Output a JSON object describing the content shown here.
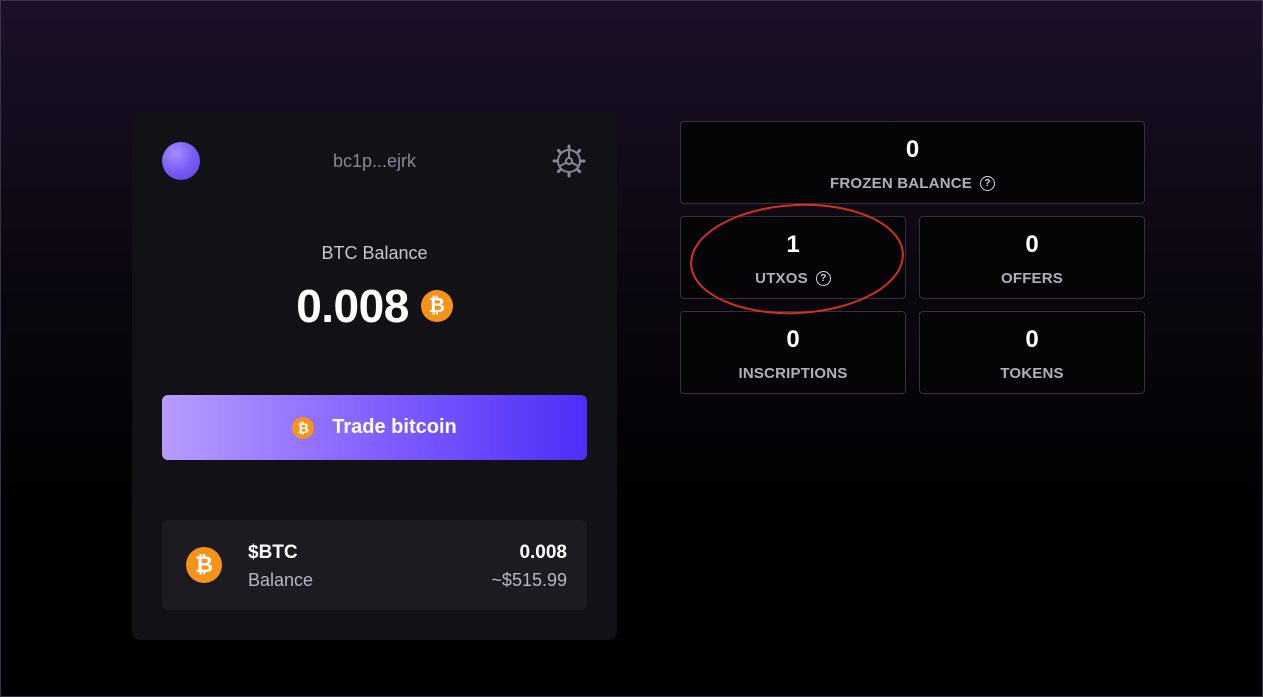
{
  "wallet": {
    "address": "bc1p...ejrk",
    "balance_label": "BTC Balance",
    "balance_value": "0.008",
    "coin_symbol": "₿",
    "trade_button": "Trade bitcoin",
    "asset": {
      "symbol": "$BTC",
      "sub": "Balance",
      "amount": "0.008",
      "usd": "~$515.99"
    },
    "icons": {
      "avatar": "avatar-gradient",
      "settings": "settings-icon",
      "coin": "bitcoin-icon"
    }
  },
  "stats": {
    "frozen": {
      "value": "0",
      "label": "FROZEN BALANCE"
    },
    "utxos": {
      "value": "1",
      "label": "UTXOS"
    },
    "offers": {
      "value": "0",
      "label": "OFFERS"
    },
    "inscriptions": {
      "value": "0",
      "label": "INSCRIPTIONS"
    },
    "tokens": {
      "value": "0",
      "label": "TOKENS"
    },
    "help_glyph": "?"
  },
  "colors": {
    "accent_start": "#b79cff",
    "accent_end": "#4e2ef7",
    "bitcoin": "#f7931a",
    "highlight": "#d8301c"
  }
}
